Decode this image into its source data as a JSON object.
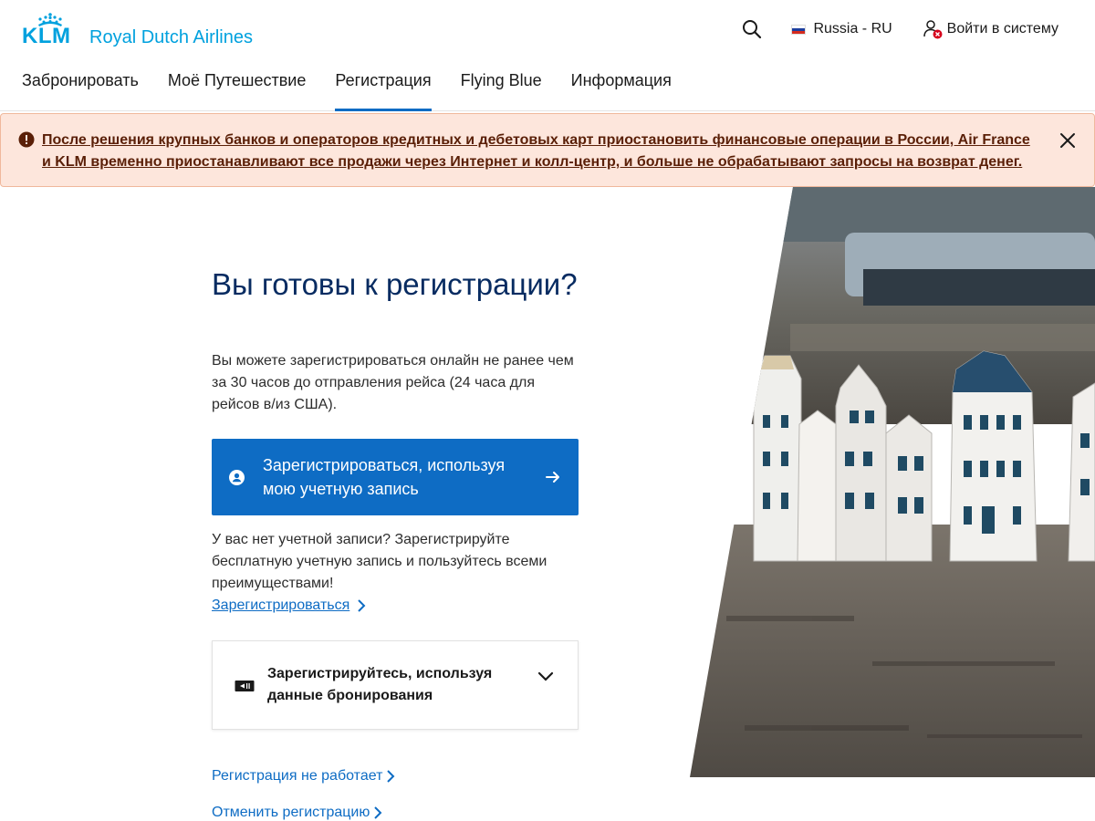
{
  "brand": {
    "logo_text": "KLM",
    "name": "Royal Dutch Airlines",
    "color": "#00a1de"
  },
  "header": {
    "search_icon": "search-icon",
    "language": "Russia - RU",
    "login": "Войти в систему"
  },
  "nav": {
    "items": [
      {
        "label": "Забронировать"
      },
      {
        "label": "Моё Путешествие"
      },
      {
        "label": "Регистрация"
      },
      {
        "label": "Flying Blue"
      },
      {
        "label": "Информация"
      }
    ],
    "active": "Регистрация"
  },
  "alert": {
    "text": "После решения крупных банков и операторов кредитных и дебетовых карт приостановить финансовые операции в России, Air France и KLM временно приостанавливают все продажи через Интернет и колл-центр, и больше не обрабатывают запросы на возврат денег."
  },
  "main": {
    "headline": "Вы готовы к регистрации?",
    "intro": "Вы можете зарегистрироваться онлайн не ранее чем за 30 часов до отправления рейса (24 часа для рейсов в/из США).",
    "primary_button": "Зарегистрироваться, используя мою учетную запись",
    "no_account_text": "У вас нет учетной записи? Зарегистрируйте бесплатную учетную запись и пользуйтесь всеми преимуществами!",
    "register_link": "Зарегистрироваться",
    "booking_card": "Зарегистрируйтесь, используя данные бронирования",
    "link_not_working": "Регистрация не работает",
    "link_cancel": "Отменить регистрацию"
  },
  "colors": {
    "primary": "#0e6cc4",
    "heading": "#072b61",
    "alert_bg": "#fde6dc",
    "alert_text": "#5a1f07"
  }
}
